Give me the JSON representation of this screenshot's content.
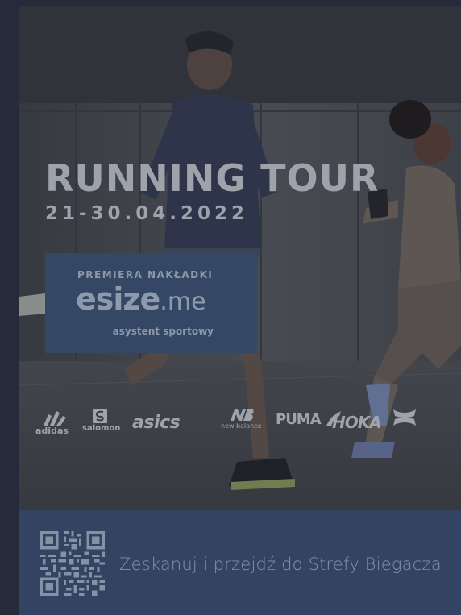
{
  "promo_card": {
    "title": "RUNNING TOUR",
    "date": "21-30.04.2022",
    "banner": {
      "kicker": "PREMIERA NAKŁADKI",
      "brand_main": "esize",
      "brand_suffix": ".me",
      "tagline": "asystent sportowy"
    },
    "brands": {
      "adidas": "adidas",
      "salomon": "salomon",
      "asics": "asics",
      "new_balance": "new balance",
      "puma": "PUMA",
      "hoka": "HOKA",
      "under_armour_icon": "under-armour-logo-icon"
    },
    "call_to_action": "Zeskanuj i przejdź do Strefy Biegacza",
    "qr_icon": "qr-code-icon"
  },
  "colors": {
    "background": "#252b3a",
    "banner_blue": "#344866",
    "footer_blue": "#334462",
    "title_gray": "#9ea2aa"
  }
}
